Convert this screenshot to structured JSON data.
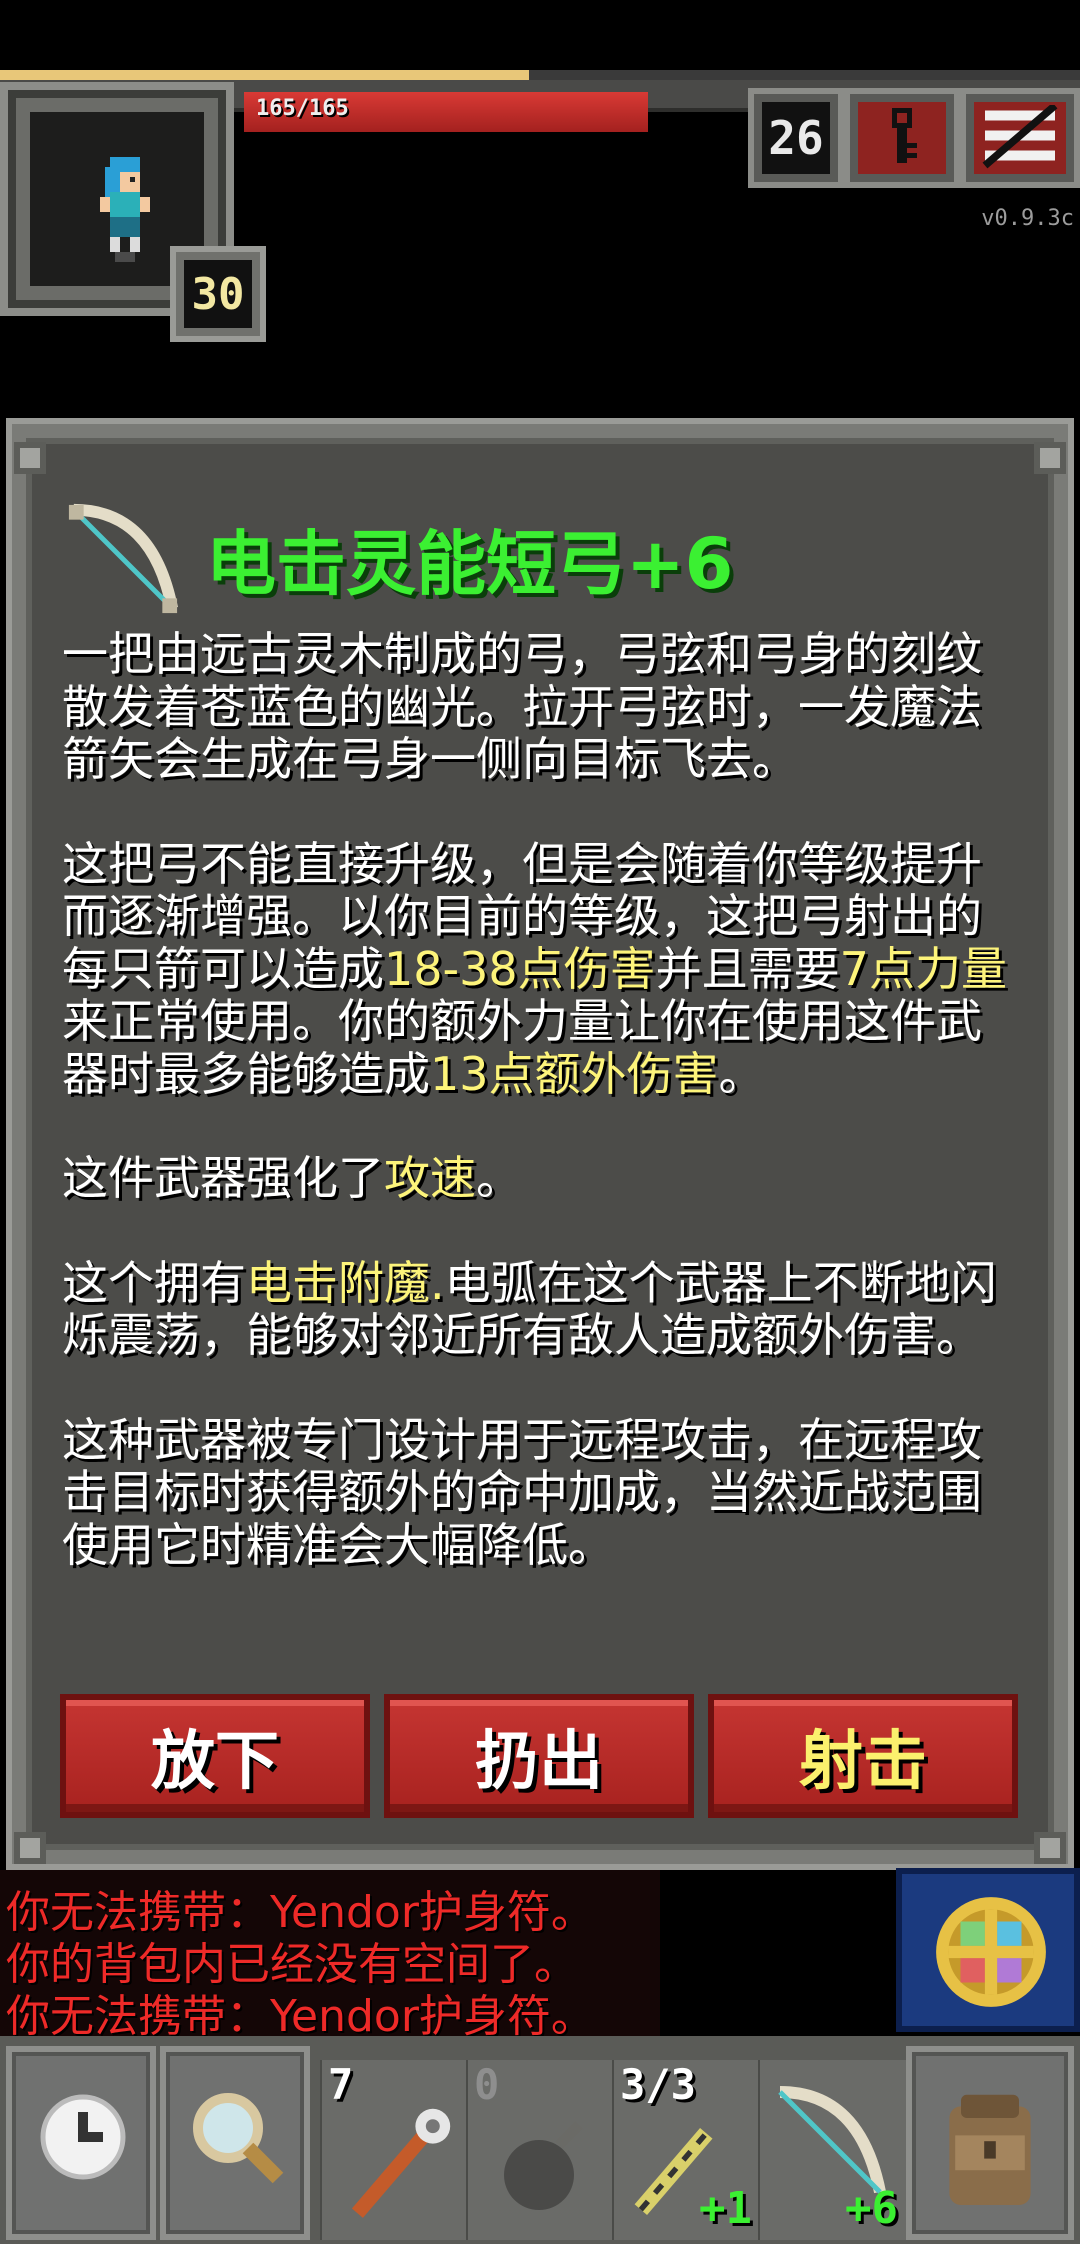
{
  "hud": {
    "hp_text": "165/165",
    "hp_fraction": 1.0,
    "xp_fraction": 0.49,
    "hero_level": "30",
    "depth": "26",
    "version": "v0.9.3c"
  },
  "dialog": {
    "title": "电击灵能短弓+6",
    "paragraphs": [
      [
        {
          "t": "一把由远古灵木制成的弓，弓弦和弓身的刻纹散发着苍蓝色的幽光。拉开弓弦时，一发魔法箭矢会生成在弓身一侧向目标飞去。"
        }
      ],
      [
        {
          "t": "这把弓不能直接升级，但是会随着你等级提升而逐渐增强。以你目前的等级，这把弓射出的每只箭可以造成"
        },
        {
          "t": "18-38点伤害",
          "hl": true
        },
        {
          "t": "并且需要"
        },
        {
          "t": "7点力量",
          "hl": true
        },
        {
          "t": "来正常使用。你的额外力量让你在使用这件武器时最多能够造成"
        },
        {
          "t": "13点额外伤害",
          "hl": true
        },
        {
          "t": "。"
        }
      ],
      [
        {
          "t": "这件武器强化了"
        },
        {
          "t": "攻速",
          "hl": true
        },
        {
          "t": "。"
        }
      ],
      [
        {
          "t": "这个拥有"
        },
        {
          "t": "电击附魔.",
          "hl": true
        },
        {
          "t": "电弧在这个武器上不断地闪烁震荡，能够对邻近所有敌人造成额外伤害。"
        }
      ],
      [
        {
          "t": "这种武器被专门设计用于远程攻击，在远程攻击目标时获得额外的命中加成，当然近战范围使用它时精准会大幅降低。"
        }
      ]
    ],
    "buttons": {
      "drop": "放下",
      "throw": "扔出",
      "shoot": "射击"
    }
  },
  "log": [
    "你无法携带：Yendor护身符。",
    "你的背包内已经没有空间了。",
    "你无法携带：Yendor护身符。"
  ],
  "quickslots": [
    {
      "label": "7",
      "upgrade": "",
      "icon": "staff-icon"
    },
    {
      "label": "0",
      "upgrade": "",
      "icon": "bomb-icon"
    },
    {
      "label": "3/3",
      "upgrade": "+1",
      "icon": "wand-icon"
    },
    {
      "label": "",
      "upgrade": "+6",
      "icon": "bow-icon"
    }
  ],
  "colors": {
    "title_green": "#3bf032",
    "highlight_yellow": "#fdf47a",
    "log_red": "#ee2a28",
    "button_red": "#b82a27"
  }
}
